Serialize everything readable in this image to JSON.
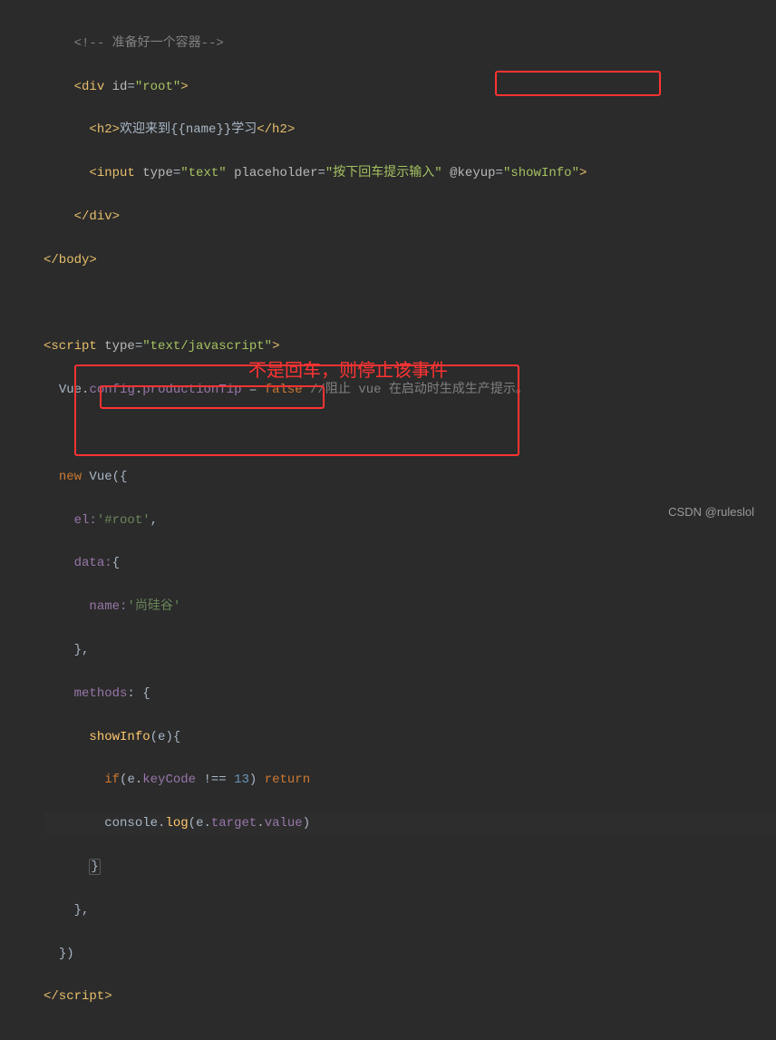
{
  "code": {
    "line1_comment": "<!-- 准备好一个容器-->",
    "line2_open": "<div ",
    "line2_attr": "id",
    "line2_eq": "=",
    "line2_val": "\"root\"",
    "line2_close": ">",
    "line3_open": "<h2>",
    "line3_text": "欢迎来到{{name}}学习",
    "line3_close": "</h2>",
    "line4_open": "<input ",
    "line4_attr1": "type",
    "line4_val1": "\"text\"",
    "line4_attr2": "placeholder",
    "line4_val2": "\"按下回车提示输入\"",
    "line4_attr3": "@keyup",
    "line4_val3": "\"showInfo\"",
    "line4_close": ">",
    "line5": "</div>",
    "line6": "</body>",
    "line8_open": "<script ",
    "line8_attr": "type",
    "line8_val": "\"text/javascript\"",
    "line8_close": ">",
    "line9_vue": "Vue",
    "line9_dot1": ".",
    "line9_config": "config",
    "line9_dot2": ".",
    "line9_prodtip": "productionTip",
    "line9_eq": " = ",
    "line9_false": "false",
    "line9_comment": " //阻止 vue 在启动时生成生产提示。",
    "line11_new": "new ",
    "line11_vue": "Vue",
    "line11_open": "({",
    "line12_el": "el:",
    "line12_val": "'#root'",
    "line12_comma": ",",
    "line13_data": "data:",
    "line13_open": "{",
    "line14_name": "name:",
    "line14_val": "'尚硅谷'",
    "line15_close": "},",
    "line16_methods": "methods",
    "line16_colon": ": {",
    "line17_showInfo": "showInfo",
    "line17_param": "(",
    "line17_e": "e",
    "line17_paren": ")",
    "line17_brace": "{",
    "line18_if": "if",
    "line18_open": "(",
    "line18_e": "e",
    "line18_dot": ".",
    "line18_keycode": "keyCode",
    "line18_neq": " !== ",
    "line18_13": "13",
    "line18_close": ") ",
    "line18_return": "return",
    "line19_console": "console",
    "line19_dot": ".",
    "line19_log": "log",
    "line19_open": "(",
    "line19_e": "e",
    "line19_dot2": ".",
    "line19_target": "target",
    "line19_dot3": ".",
    "line19_value": "value",
    "line19_close": ")",
    "line20_close": "}",
    "line21_close": "},",
    "line22_close": "})",
    "line23_close": "</script>"
  },
  "annotation": "不是回车，则停止该事件",
  "watermark": "CSDN @ruleslol"
}
